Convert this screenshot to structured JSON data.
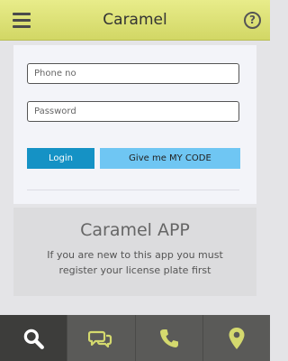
{
  "header": {
    "title": "Caramel",
    "menu_icon": "hamburger-menu-icon",
    "help_icon": "help-circle-icon",
    "help_glyph": "?",
    "background": "#dde27a"
  },
  "login_form": {
    "phone": {
      "placeholder": "Phone no",
      "value": ""
    },
    "password": {
      "placeholder": "Password",
      "value": ""
    },
    "login_label": "Login",
    "code_label": "Give me MY CODE",
    "login_color": "#1592c5",
    "code_color": "#6fc6f3"
  },
  "info": {
    "title": "Caramel APP",
    "text": "If you are new to this app you must register your license plate first"
  },
  "tabs": [
    {
      "icon": "search-icon",
      "active": true
    },
    {
      "icon": "chat-icon",
      "active": false
    },
    {
      "icon": "phone-icon",
      "active": false
    },
    {
      "icon": "location-pin-icon",
      "active": false
    }
  ],
  "colors": {
    "footer_bg": "#5a5a58",
    "footer_active": "#3d3d3b",
    "tab_icon": "#d4d96e"
  }
}
